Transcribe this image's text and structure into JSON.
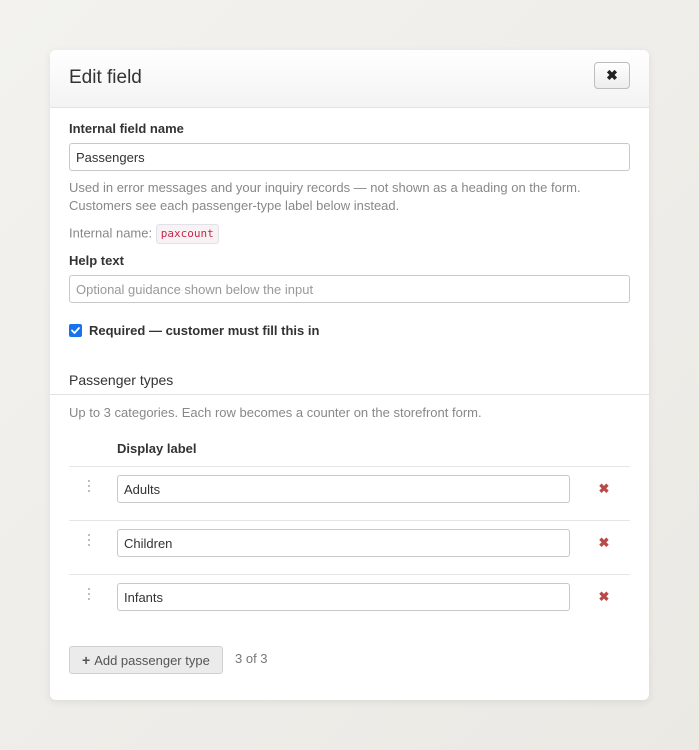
{
  "modal": {
    "title": "Edit field",
    "close_glyph": "✖"
  },
  "field_name": {
    "label": "Internal field name",
    "value": "Passengers",
    "help_line1": "Used in error messages and your inquiry records — not shown as a heading on the form.",
    "help_line2": "Customers see each passenger-type label below instead.",
    "internal_name_label": "Internal name:",
    "internal_name_code": "paxcount"
  },
  "help_text": {
    "label": "Help text",
    "value": "",
    "placeholder": "Optional guidance shown below the input"
  },
  "required": {
    "checked": true,
    "label": "Required — customer must fill this in"
  },
  "passenger_types": {
    "heading": "Passenger types",
    "description": "Up to 3 categories. Each row becomes a counter on the storefront form.",
    "column_header": "Display label",
    "rows": [
      {
        "label": "Adults"
      },
      {
        "label": "Children"
      },
      {
        "label": "Infants"
      }
    ],
    "add_button_icon": "+",
    "add_button_label": "Add passenger type",
    "count_text": "3 of 3"
  },
  "icons": {
    "close": "close-icon",
    "drag": "drag-handle-icon",
    "remove": "remove-icon",
    "add": "plus-icon",
    "check": "checkmark-icon"
  },
  "colors": {
    "remove": "#b94a48",
    "checkbox": "#1a73e8",
    "code_text": "#c7254e"
  }
}
